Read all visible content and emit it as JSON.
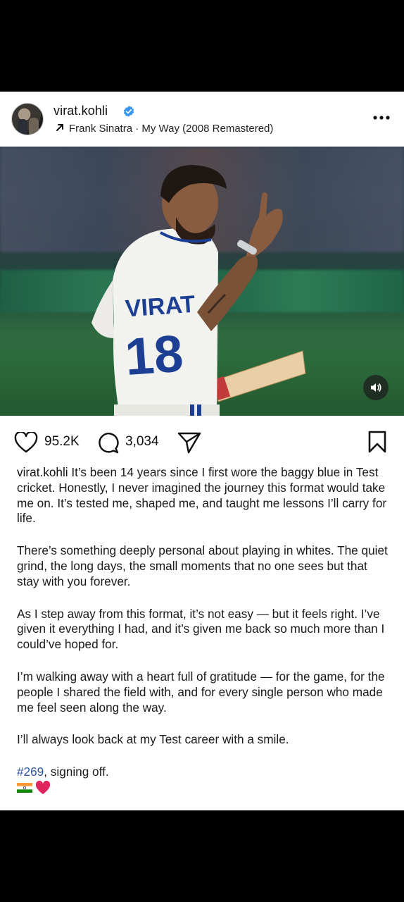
{
  "post": {
    "username": "virat.kohli",
    "verified": true,
    "music": "Frank Sinatra · My Way (2008 Remastered)",
    "likes": "95.2K",
    "comments": "3,034"
  },
  "photo": {
    "jersey_name": "VIRAT",
    "jersey_number": "18"
  },
  "caption": {
    "username": "virat.kohli",
    "paragraph1": " It’s been 14 years since I first wore the baggy blue in Test cricket. Honestly, I never imagined the journey this format would take me on. It’s tested me, shaped me, and taught me lessons I’ll carry for life.",
    "paragraph2": "There’s something deeply personal about playing in whites. The quiet grind, the long days, the small moments that no one sees but that stay with you forever.",
    "paragraph3": "As I step away from this format, it’s not easy — but it feels right. I’ve given it everything I had, and it’s given me back so much more than I could’ve hoped for.",
    "paragraph4": "I’m walking away with a heart full of gratitude — for the game, for the people I shared the field with, and for every single person who made me feel seen along the way.",
    "paragraph5": "I’ll always look back at my Test career with a smile.",
    "hashtag": "#269",
    "sign_off": ", signing off.",
    "emojis": [
      "india-flag-icon",
      "red-heart-icon"
    ]
  },
  "colors": {
    "verified_blue": "#3897f0",
    "hashtag_blue": "#2f56a3",
    "heart_red": "#e0245e"
  }
}
